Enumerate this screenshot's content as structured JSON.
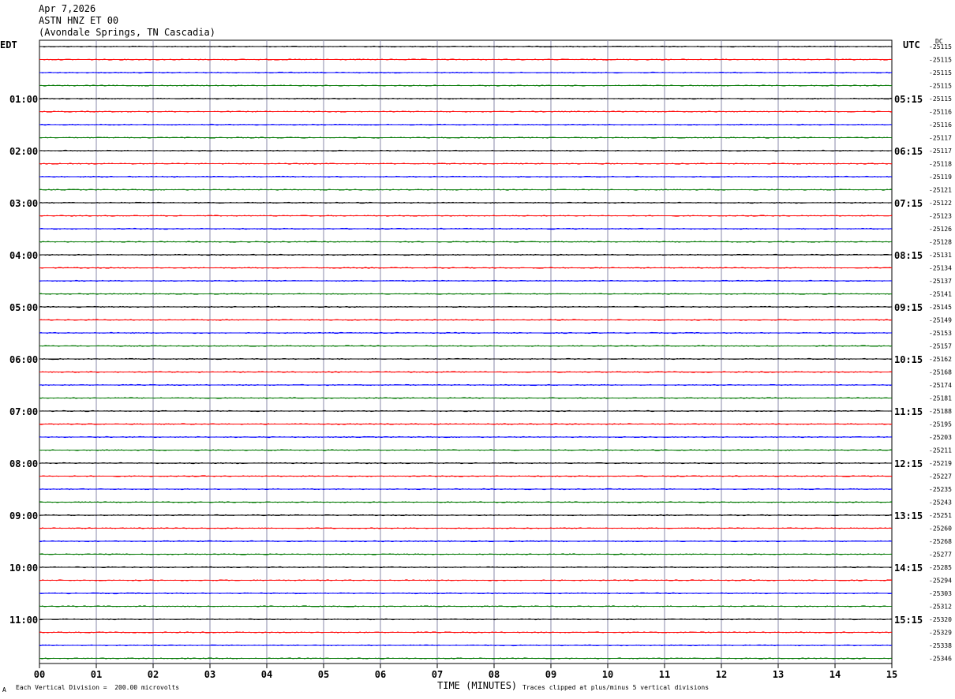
{
  "header": {
    "date": "Apr 7,2026",
    "station": "ASTN HNZ ET 00",
    "location": "(Avondale Springs, TN Cascadia)"
  },
  "left_timezone": "EDT",
  "right_timezone": "UTC",
  "dc_label": "DC",
  "footer": {
    "scale_note": "Each Vertical Division =  200.00 microvolts",
    "clip_note": "Traces clipped at plus/minus 5 vertical divisions",
    "corner_mark": "A"
  },
  "chart_data": {
    "type": "line",
    "xlabel": "TIME (MINUTES)",
    "x_ticks": [
      "00",
      "01",
      "02",
      "03",
      "04",
      "05",
      "06",
      "07",
      "08",
      "09",
      "10",
      "11",
      "12",
      "13",
      "14",
      "15"
    ],
    "xlim": [
      0,
      15
    ],
    "trace_colors": [
      "#000000",
      "#ff0000",
      "#0000ff",
      "#007700"
    ],
    "left_hour_labels": [
      "01:00",
      "02:00",
      "03:00",
      "04:00",
      "05:00",
      "06:00",
      "07:00",
      "08:00",
      "09:00",
      "10:00",
      "11:00"
    ],
    "right_hour_labels": [
      "05:15",
      "06:15",
      "07:15",
      "08:15",
      "09:15",
      "10:15",
      "11:15",
      "12:15",
      "13:15",
      "14:15",
      "15:15"
    ],
    "dc_offsets": [
      "-25115",
      "-25115",
      "-25115",
      "-25115",
      "-25115",
      "-25116",
      "-25116",
      "-25117",
      "-25117",
      "-25118",
      "-25119",
      "-25121",
      "-25122",
      "-25123",
      "-25126",
      "-25128",
      "-25131",
      "-25134",
      "-25137",
      "-25141",
      "-25145",
      "-25149",
      "-25153",
      "-25157",
      "-25162",
      "-25168",
      "-25174",
      "-25181",
      "-25188",
      "-25195",
      "-25203",
      "-25211",
      "-25219",
      "-25227",
      "-25235",
      "-25243",
      "-25251",
      "-25260",
      "-25268",
      "-25277",
      "-25285",
      "-25294",
      "-25303",
      "-25312",
      "-25320",
      "-25329",
      "-25338",
      "-25346"
    ]
  }
}
